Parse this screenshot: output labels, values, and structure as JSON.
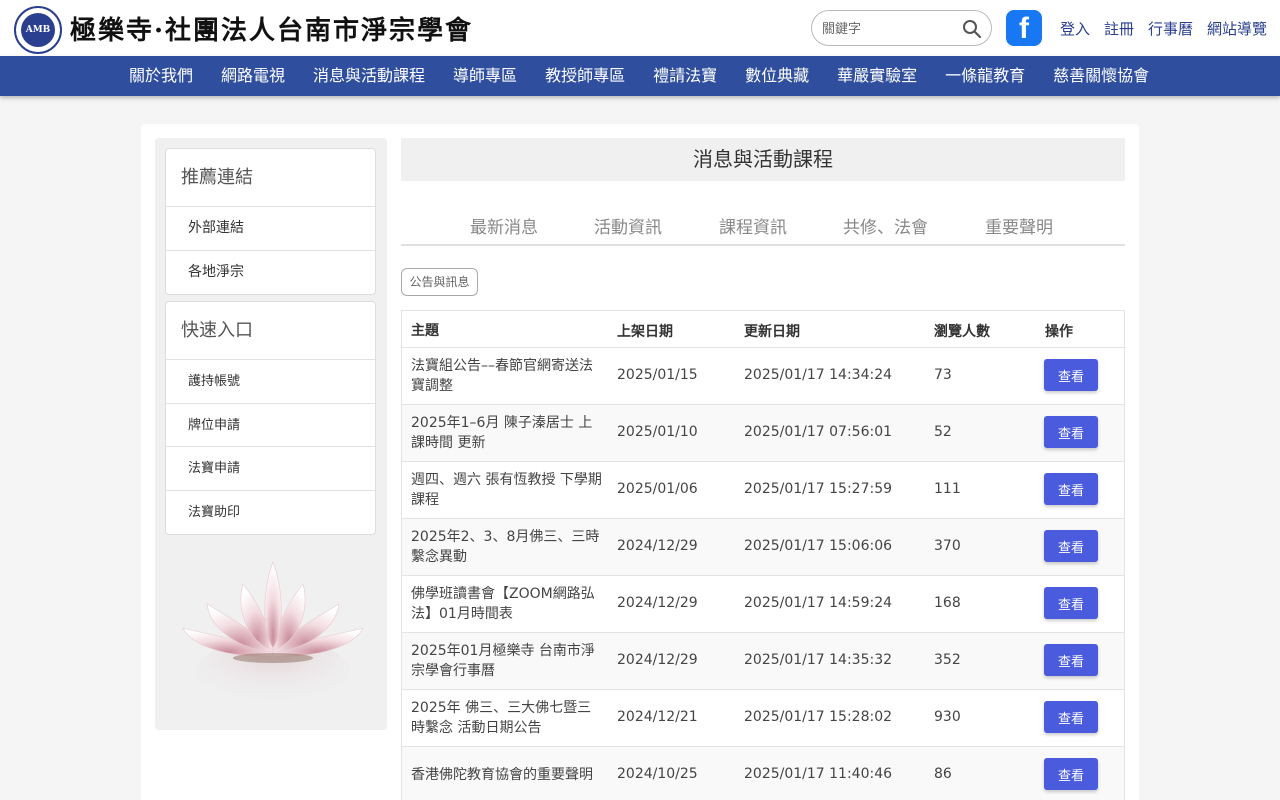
{
  "header": {
    "logo_text": "極樂寺·社團法人台南市淨宗學會",
    "logo_seal_label": "AMB",
    "search": {
      "placeholder": "關鍵字",
      "value": ""
    },
    "util_links": [
      "登入",
      "註冊",
      "行事曆",
      "網站導覽"
    ]
  },
  "nav": {
    "items": [
      "關於我們",
      "網路電視",
      "消息與活動課程",
      "導師專區",
      "教授師專區",
      "禮請法寶",
      "數位典藏",
      "華嚴實驗室",
      "一條龍教育",
      "慈善關懷協會"
    ]
  },
  "sidebar": {
    "recommended": {
      "title": "推薦連結",
      "items": [
        "外部連結",
        "各地淨宗"
      ]
    },
    "quick": {
      "title": "快速入口",
      "items": [
        "護持帳號",
        "牌位申請",
        "法寶申請",
        "法寶助印"
      ]
    }
  },
  "content": {
    "title": "消息與活動課程",
    "tabs": [
      "最新消息",
      "活動資訊",
      "課程資訊",
      "共修、法會",
      "重要聲明"
    ],
    "tag": "公告與訊息",
    "table": {
      "headers": [
        "主題",
        "上架日期",
        "更新日期",
        "瀏覽人數",
        "操作"
      ],
      "rows": [
        {
          "title": "法寶組公告––春節官網寄送法寶調整",
          "posted": "2025/01/15",
          "updated": "2025/01/17 14:34:24",
          "views": "73",
          "action": "查看"
        },
        {
          "title": "2025年1–6月 陳子溱居士 上課時間 更新",
          "posted": "2025/01/10",
          "updated": "2025/01/17 07:56:01",
          "views": "52",
          "action": "查看"
        },
        {
          "title": "週四、週六 張有恆教授 下學期課程",
          "posted": "2025/01/06",
          "updated": "2025/01/17 15:27:59",
          "views": "111",
          "action": "查看"
        },
        {
          "title": "2025年2、3、8月佛三、三時繫念異動",
          "posted": "2024/12/29",
          "updated": "2025/01/17 15:06:06",
          "views": "370",
          "action": "查看"
        },
        {
          "title": "佛學班讀書會【ZOOM網路弘法】01月時間表",
          "posted": "2024/12/29",
          "updated": "2025/01/17 14:59:24",
          "views": "168",
          "action": "查看"
        },
        {
          "title": "2025年01月極樂寺 台南市淨宗學會行事曆",
          "posted": "2024/12/29",
          "updated": "2025/01/17 14:35:32",
          "views": "352",
          "action": "查看"
        },
        {
          "title": "2025年 佛三、三大佛七暨三時繫念 活動日期公告",
          "posted": "2024/12/21",
          "updated": "2025/01/17 15:28:02",
          "views": "930",
          "action": "查看"
        },
        {
          "title": "香港佛陀教育協會的重要聲明",
          "posted": "2024/10/25",
          "updated": "2025/01/17 11:40:46",
          "views": "86",
          "action": "查看"
        }
      ]
    }
  },
  "colors": {
    "nav_bg": "#2f4f9e",
    "link": "#2a3f8f",
    "button": "#4a5bde",
    "facebook": "#1877f2"
  }
}
